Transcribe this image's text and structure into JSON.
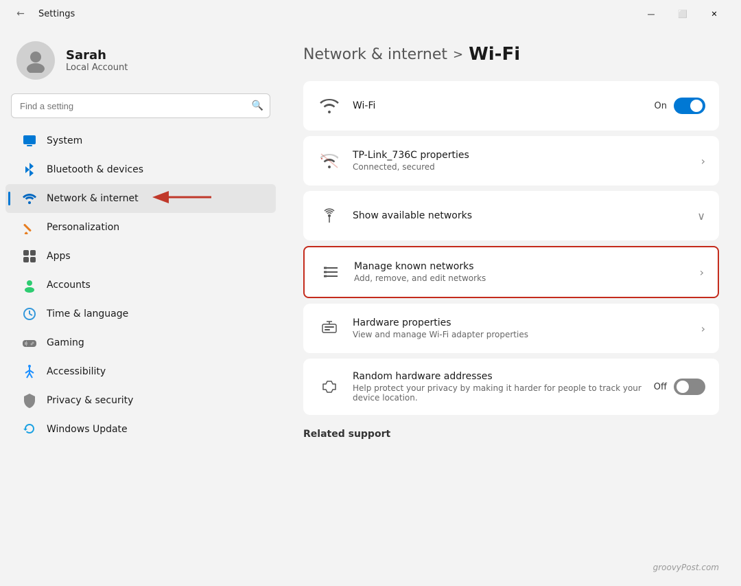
{
  "titlebar": {
    "title": "Settings",
    "back_label": "←",
    "btn_minimize": "—",
    "btn_maximize": "⬜",
    "btn_close": "✕"
  },
  "user": {
    "name": "Sarah",
    "account_type": "Local Account"
  },
  "search": {
    "placeholder": "Find a setting"
  },
  "nav": {
    "items": [
      {
        "id": "system",
        "label": "System",
        "icon": "🖥️"
      },
      {
        "id": "bluetooth",
        "label": "Bluetooth & devices",
        "icon": "🔵"
      },
      {
        "id": "network",
        "label": "Network & internet",
        "icon": "💎",
        "active": true
      },
      {
        "id": "personalization",
        "label": "Personalization",
        "icon": "✏️"
      },
      {
        "id": "apps",
        "label": "Apps",
        "icon": "🧩"
      },
      {
        "id": "accounts",
        "label": "Accounts",
        "icon": "👤"
      },
      {
        "id": "time",
        "label": "Time & language",
        "icon": "🌐"
      },
      {
        "id": "gaming",
        "label": "Gaming",
        "icon": "🎮"
      },
      {
        "id": "accessibility",
        "label": "Accessibility",
        "icon": "♿"
      },
      {
        "id": "privacy",
        "label": "Privacy & security",
        "icon": "🛡️"
      },
      {
        "id": "update",
        "label": "Windows Update",
        "icon": "🔄"
      }
    ]
  },
  "breadcrumb": {
    "parent": "Network & internet",
    "separator": ">",
    "current": "Wi-Fi"
  },
  "wifi_section": {
    "items": [
      {
        "id": "wifi-toggle",
        "title": "Wi-Fi",
        "subtitle": null,
        "toggle": true,
        "toggle_state": "on",
        "toggle_label": "On",
        "has_chevron": false,
        "highlighted": false
      },
      {
        "id": "tp-link",
        "title": "TP-Link_736C properties",
        "subtitle": "Connected, secured",
        "toggle": false,
        "has_chevron": true,
        "highlighted": false
      },
      {
        "id": "show-networks",
        "title": "Show available networks",
        "subtitle": null,
        "toggle": false,
        "has_chevron": true,
        "chevron_down": true,
        "highlighted": false
      },
      {
        "id": "manage-networks",
        "title": "Manage known networks",
        "subtitle": "Add, remove, and edit networks",
        "toggle": false,
        "has_chevron": true,
        "highlighted": true
      },
      {
        "id": "hardware-props",
        "title": "Hardware properties",
        "subtitle": "View and manage Wi-Fi adapter properties",
        "toggle": false,
        "has_chevron": true,
        "highlighted": false
      },
      {
        "id": "random-hw",
        "title": "Random hardware addresses",
        "subtitle": "Help protect your privacy by making it harder for people to track your device location.",
        "toggle": true,
        "toggle_state": "off",
        "toggle_label": "Off",
        "has_chevron": false,
        "highlighted": false
      }
    ]
  },
  "related_support": {
    "label": "Related support"
  },
  "watermark": "groovyPost.com"
}
